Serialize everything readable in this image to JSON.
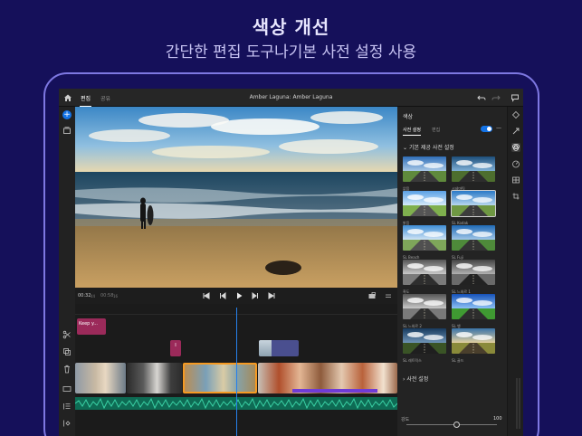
{
  "promo": {
    "title": "색상 개선",
    "subtitle": "간단한 편집 도구나기본 사전 설정 사용"
  },
  "app": {
    "topbar": {
      "tab_edit": "편집",
      "tab_share": "공유",
      "project_title": "Amber Laguna: Amber Laguna"
    },
    "transport": {
      "current_time": "00:32",
      "current_frames": "44",
      "duration": "00:58",
      "duration_frames": "16"
    },
    "timeline": {
      "title_clip": "Keep y...",
      "small_clip": "I"
    },
    "panel": {
      "title": "색상",
      "tab_presets": "사전 설정",
      "tab_edit": "편집",
      "toggle_on": true,
      "section_builtin": "기본 제공 사전 설정",
      "section_presets": "사전 설정",
      "presets": [
        {
          "label": "없음",
          "style": "none"
        },
        {
          "label": "시네마틱",
          "style": "cine"
        },
        {
          "label": "밝음",
          "style": "bright"
        },
        {
          "label": "SL Kodak",
          "style": "kodak",
          "selected": true
        },
        {
          "label": "SL Beach",
          "style": "beach"
        },
        {
          "label": "SL Fuji",
          "style": "fuji"
        },
        {
          "label": "흑도",
          "style": "bw"
        },
        {
          "label": "SL 느와르 1",
          "style": "bw2"
        },
        {
          "label": "SL 느와르 2",
          "style": "bw"
        },
        {
          "label": "SL 뱅",
          "style": "vivid"
        },
        {
          "label": "SL 레트릭스",
          "style": "dark"
        },
        {
          "label": "SL 골드",
          "style": "gold"
        }
      ],
      "intensity_label": "강도",
      "intensity_value": "100",
      "intensity_level": 0.55
    },
    "colors": {
      "accent": "#1473e6",
      "page_bg": "#15105a",
      "title_clip": "#9b2a5a",
      "audio": "#0e6b54",
      "selected_clip": "#f59a23"
    }
  }
}
